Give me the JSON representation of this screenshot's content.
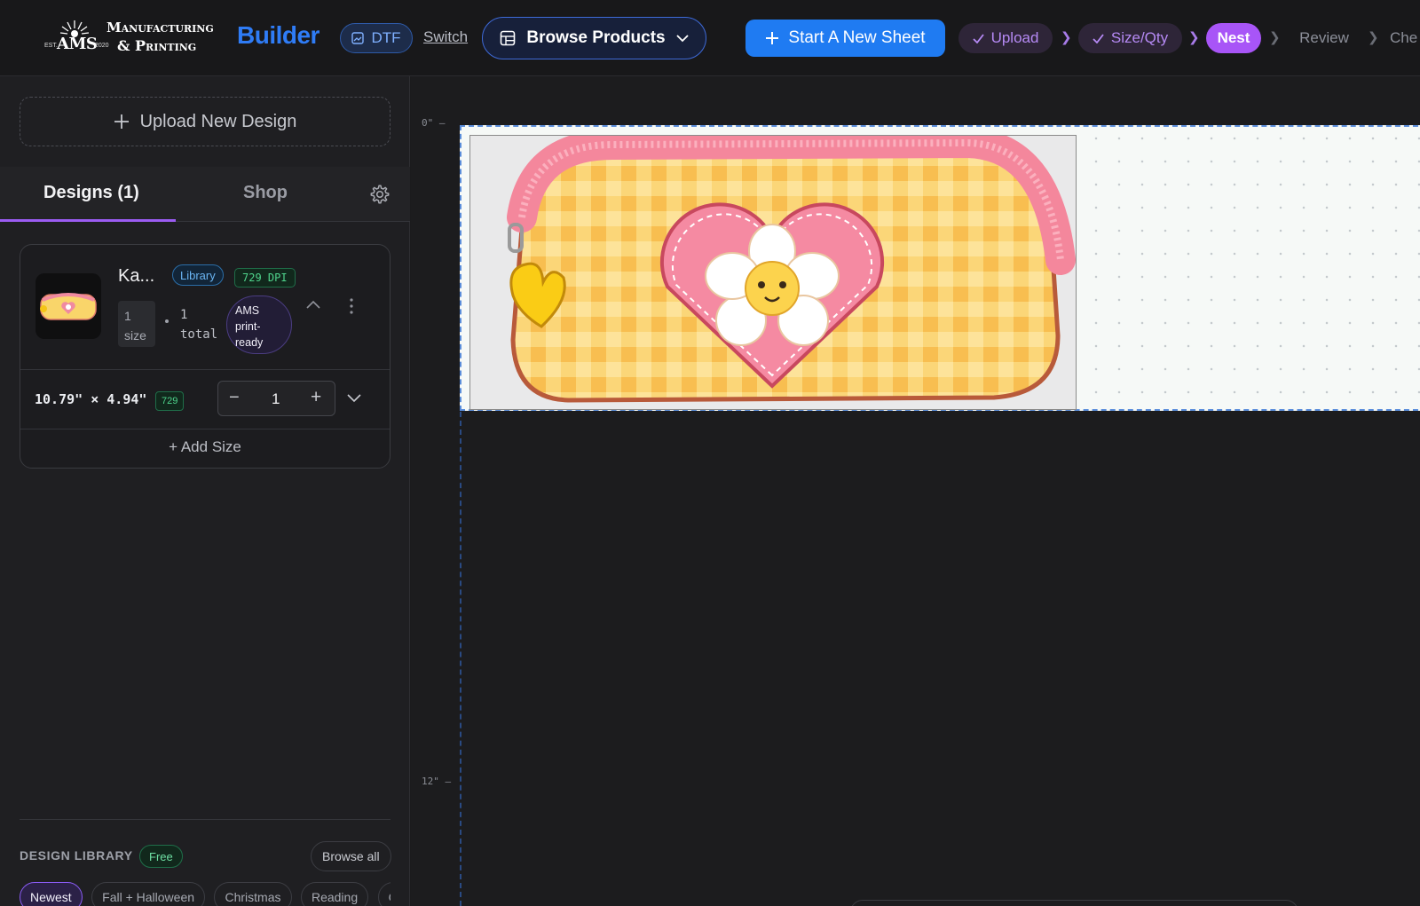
{
  "header": {
    "logo": {
      "est": "EST.",
      "ams": "AMS",
      "year": "2020",
      "line1": "Manufacturing",
      "line2": "& Printing"
    },
    "builder_title": "Builder",
    "mode_label": "DTF",
    "switch_label": "Switch",
    "browse_label": "Browse Products",
    "start_label": "Start A New Sheet",
    "steps": [
      {
        "label": "Upload",
        "state": "done"
      },
      {
        "label": "Size/Qty",
        "state": "done"
      },
      {
        "label": "Nest",
        "state": "active"
      },
      {
        "label": "Review",
        "state": "todo"
      },
      {
        "label": "Che",
        "state": "todo"
      }
    ]
  },
  "sidebar": {
    "upload_label": "Upload New Design",
    "tabs": [
      {
        "label": "Designs (1)",
        "active": true
      },
      {
        "label": "Shop",
        "active": false
      }
    ],
    "design": {
      "name": "Ka...",
      "library_badge": "Library",
      "dpi_badge": "729 DPI",
      "size_count_line1": "1",
      "size_count_line2": "size",
      "total_line1": "1",
      "total_line2": "total",
      "ready_line1": "AMS",
      "ready_line2": "print-",
      "ready_line3": "ready",
      "dimensions": "10.79\" × 4.94\"",
      "dpi_small": "729",
      "quantity": "1",
      "add_size_label": "Add Size"
    },
    "library": {
      "title": "DESIGN LIBRARY",
      "free_badge": "Free",
      "browse_all": "Browse all",
      "chips": [
        "Newest",
        "Fall + Halloween",
        "Christmas",
        "Reading",
        "C"
      ]
    }
  },
  "canvas": {
    "ruler_top": "0\" —",
    "ruler_bottom": "12\" —"
  },
  "colors": {
    "accent_blue": "#1f7bf2",
    "accent_purple": "#a855f7",
    "background": "#1c1c1e"
  }
}
